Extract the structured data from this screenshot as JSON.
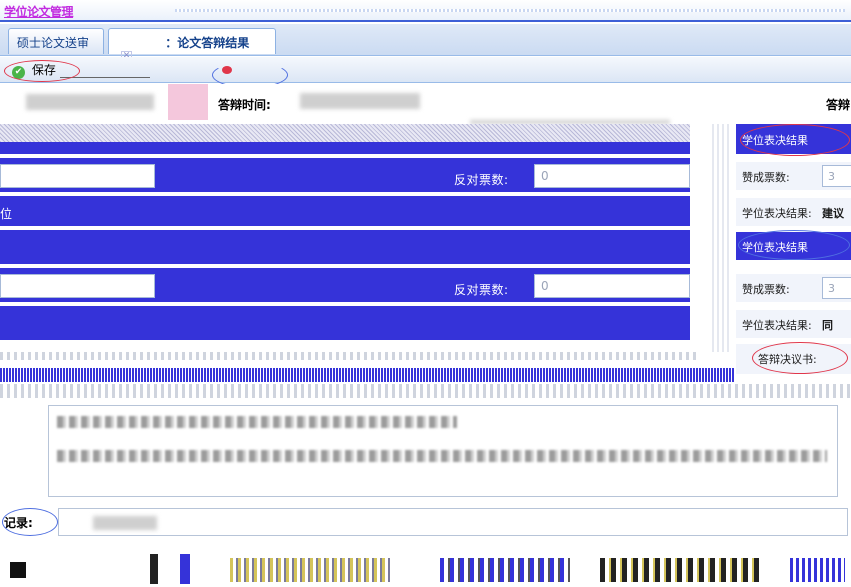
{
  "app": {
    "title": "学位论文管理"
  },
  "tabs": [
    {
      "label": "硕士论文送审"
    },
    {
      "label": "：论文答辩结果"
    }
  ],
  "toolbar": {
    "save_label": "保存"
  },
  "header": {
    "defense_time_label": "答辩时间:",
    "defense_label_right": "答辩"
  },
  "left_form": {
    "oppose_votes_label_1": "反对票数:",
    "oppose_votes_value_1": "0",
    "oppose_votes_label_2": "反对票数:",
    "oppose_votes_value_2": "0",
    "side_char": "位"
  },
  "right_panel": {
    "degree_vote_result_1": "学位表决结果",
    "approve_votes_label_1": "赞成票数:",
    "approve_votes_value_1": "3",
    "degree_vote_result_label": "学位表决结果:",
    "degree_vote_result_value": "建议",
    "degree_vote_result_2": "学位表决结果",
    "approve_votes_label_2": "赞成票数:",
    "approve_votes_value_2": "3",
    "degree_vote_result_label_2": "学位表决结果:",
    "degree_vote_result_value_2": "同",
    "defense_resolution_label": "答辩决议书:"
  },
  "record": {
    "label": "记录:"
  },
  "colors": {
    "accent_blue": "#3533d9",
    "annotation_red": "#e0364a",
    "annotation_blue": "#4f6fe0"
  }
}
